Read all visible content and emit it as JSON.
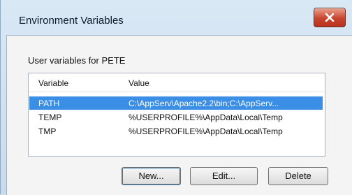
{
  "window": {
    "title": "Environment Variables"
  },
  "user_variables": {
    "group_label": "User variables for PETE",
    "columns": [
      "Variable",
      "Value"
    ],
    "rows": [
      {
        "variable": "PATH",
        "value": "C:\\AppServ\\Apache2.2\\bin;C:\\AppServ...",
        "selected": true
      },
      {
        "variable": "TEMP",
        "value": "%USERPROFILE%\\AppData\\Local\\Temp",
        "selected": false
      },
      {
        "variable": "TMP",
        "value": "%USERPROFILE%\\AppData\\Local\\Temp",
        "selected": false
      }
    ]
  },
  "buttons": {
    "new_label": "New...",
    "edit_label": "Edit...",
    "delete_label": "Delete"
  },
  "colors": {
    "selection": "#3a8ee6",
    "close_button": "#c8452f"
  },
  "icons": {
    "close": "close-icon"
  }
}
